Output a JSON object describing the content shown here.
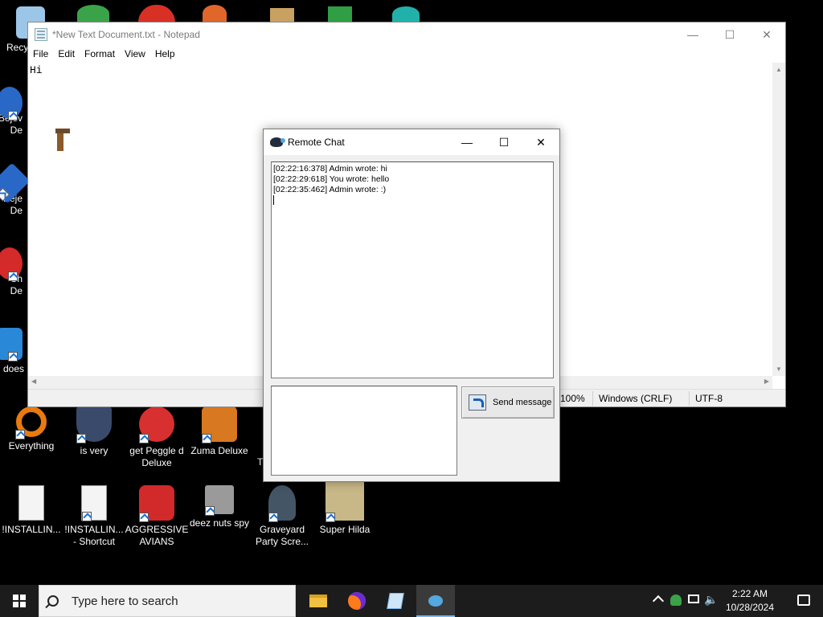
{
  "desktop_icons": [
    {
      "label": "Recy",
      "color": "#9cc6e8"
    },
    {
      "label": "Bejev\nDe",
      "color": "#2a68c8"
    },
    {
      "label": "Beje\nDe",
      "color": "#2a68c8"
    },
    {
      "label": "Ch\nDe",
      "color": "#d42a2a"
    },
    {
      "label": "does",
      "color": "#2a88d8"
    },
    {
      "label": "Everything",
      "color": "#e87a10"
    },
    {
      "label": "is very",
      "color": "#3a4a6a"
    },
    {
      "label": "get Peggle d Deluxe",
      "color": "#d83030"
    },
    {
      "label": "Zuma Deluxe",
      "color": "#d87820"
    },
    {
      "label": "Th",
      "color": "#333333"
    },
    {
      "label": "!INSTALLIN...",
      "color": "#f4f4f4"
    },
    {
      "label": "!INSTALLIN... - Shortcut",
      "color": "#f4f4f4"
    },
    {
      "label": "AGGRESSIVE AVIANS",
      "color": "#d22a2a"
    },
    {
      "label": "deez nuts spy",
      "color": "#9a9a9a"
    },
    {
      "label": "Graveyard Party Scre...",
      "color": "#445566"
    },
    {
      "label": "Super Hilda",
      "color": "#c8b888"
    }
  ],
  "notepad": {
    "title": "*New Text Document.txt - Notepad",
    "menu": [
      "File",
      "Edit",
      "Format",
      "View",
      "Help"
    ],
    "content": "Hi",
    "status": {
      "zoom": "100%",
      "line_endings": "Windows (CRLF)",
      "encoding": "UTF-8"
    }
  },
  "chat": {
    "title": "Remote Chat",
    "messages": [
      "[02:22:16:378] Admin wrote: hi",
      "[02:22:29:618] You wrote: hello",
      "[02:22:35:462] Admin wrote: :)"
    ],
    "input_value": "",
    "send_label": "Send message"
  },
  "taskbar": {
    "search_placeholder": "Type here to search",
    "time": "2:22 AM",
    "date": "10/28/2024"
  },
  "colors": {
    "accent": "#7ab7ea",
    "taskbar": "#1c1c1c",
    "desktop": "#000000"
  }
}
